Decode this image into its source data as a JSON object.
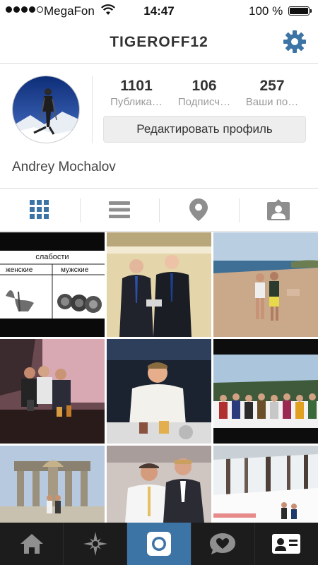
{
  "status_bar": {
    "carrier": "MegaFon",
    "time": "14:47",
    "battery": "100 %"
  },
  "header": {
    "username": "TIGEROFF12",
    "settings_icon": "gear-icon"
  },
  "profile": {
    "full_name": "Andrey Mochalov",
    "edit_label": "Редактировать профиль",
    "stats": [
      {
        "value": "1101",
        "label": "Публика…"
      },
      {
        "value": "106",
        "label": "Подписч…"
      },
      {
        "value": "257",
        "label": "Ваши по…"
      }
    ]
  },
  "view_tabs": [
    {
      "icon": "grid-icon",
      "active": true
    },
    {
      "icon": "list-icon",
      "active": false
    },
    {
      "icon": "location-pin-icon",
      "active": false
    },
    {
      "icon": "tagged-photos-icon",
      "active": false
    }
  ],
  "grid_photos": [
    {
      "kind": "collage",
      "text_title": "слабости",
      "text_left": "женские",
      "text_right": "мужские"
    },
    {
      "kind": "photo"
    },
    {
      "kind": "photo"
    },
    {
      "kind": "photo"
    },
    {
      "kind": "photo"
    },
    {
      "kind": "photo"
    },
    {
      "kind": "photo"
    },
    {
      "kind": "photo"
    },
    {
      "kind": "photo"
    }
  ],
  "tab_bar": [
    {
      "icon": "home-icon"
    },
    {
      "icon": "explore-star-icon"
    },
    {
      "icon": "camera-icon",
      "active": true
    },
    {
      "icon": "activity-heart-icon"
    },
    {
      "icon": "profile-card-icon",
      "active": true
    }
  ],
  "colors": {
    "accent": "#3d74a6",
    "tab_bar": "#1c1c1c",
    "button_bg": "#eeeeee"
  }
}
